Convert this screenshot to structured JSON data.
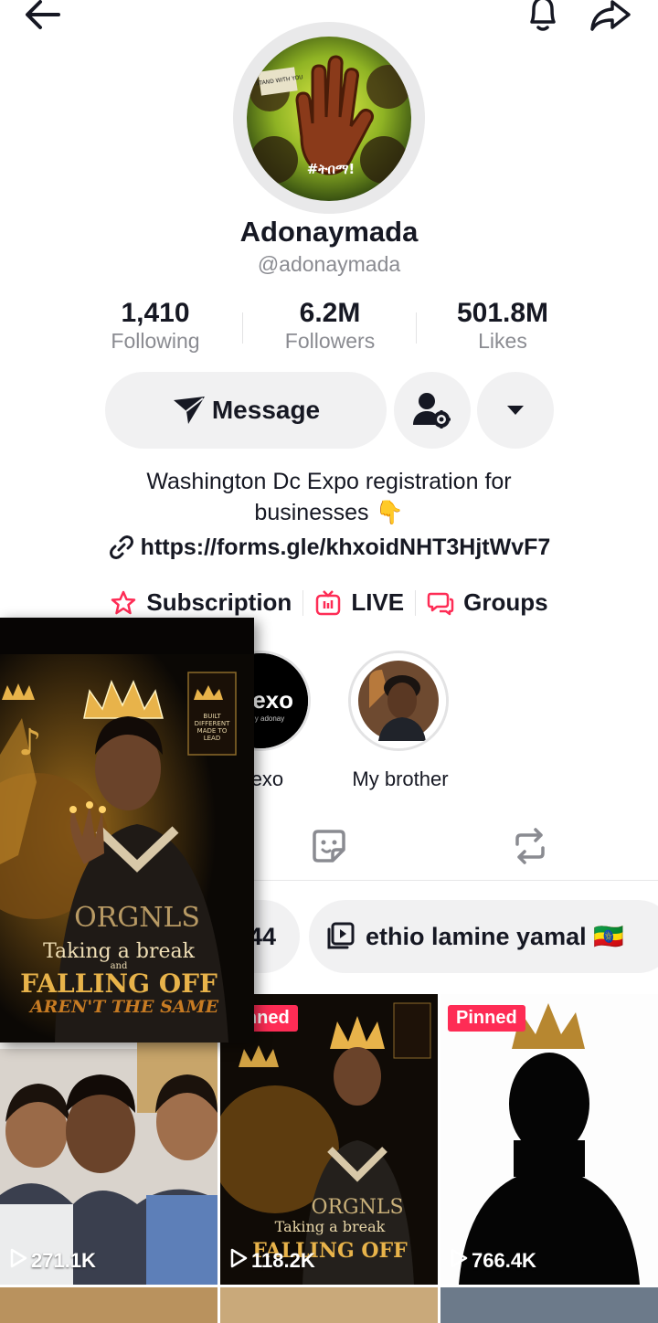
{
  "profile": {
    "display_name": "Adonaymada",
    "username": "@adonaymada",
    "avatar_caption": "#ትበማ!",
    "avatar_sign": "I STAND WITH YOU"
  },
  "stats": {
    "following": {
      "value": "1,410",
      "label": "Following"
    },
    "followers": {
      "value": "6.2M",
      "label": "Followers"
    },
    "likes": {
      "value": "501.8M",
      "label": "Likes"
    }
  },
  "actions": {
    "message_label": "Message"
  },
  "bio": {
    "line1": "Washington Dc Expo registration for",
    "line2": "businesses 👇",
    "link": "https://forms.gle/khxoidNHT3HjtWvF7"
  },
  "meta_links": [
    {
      "label": "Subscription"
    },
    {
      "label": "LIVE"
    },
    {
      "label": "Groups"
    }
  ],
  "highlights": [
    {
      "label": "lexo",
      "logo_text": "lexo",
      "logo_sub": "y adonay"
    },
    {
      "label": "My brother"
    }
  ],
  "playlists": [
    {
      "label": "44"
    },
    {
      "label": "ethio lamine yamal 🇪🇹"
    }
  ],
  "videos": [
    {
      "views": "271.1K",
      "pinned": false,
      "pinned_label": ""
    },
    {
      "views": "118.2K",
      "pinned": true,
      "pinned_label": "Pinned"
    },
    {
      "views": "766.4K",
      "pinned": true,
      "pinned_label": "Pinned"
    }
  ],
  "poster": {
    "line1": "ORGNLS",
    "line2": "Taking a break",
    "line3": "and",
    "line4": "FALLING OFF",
    "line5": "AREN'T THE SAME",
    "banner": "BUILT DIFFERENT MADE TO LEAD"
  },
  "colors": {
    "accent": "#fe2c55",
    "text": "#161823",
    "secondary": "#8a8b91",
    "button_bg": "#f1f1f2",
    "gold": "#e8b34a"
  }
}
